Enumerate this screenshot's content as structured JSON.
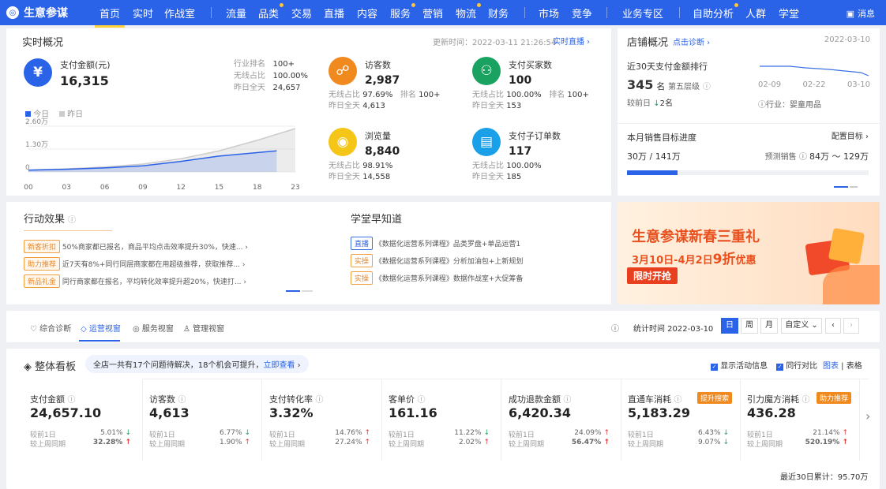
{
  "nav": {
    "brand": "生意参谋",
    "items": [
      "首页",
      "实时",
      "作战室",
      "流量",
      "品类",
      "交易",
      "直播",
      "内容",
      "服务",
      "营销",
      "物流",
      "财务",
      "市场",
      "竞争",
      "业务专区",
      "自助分析",
      "人群",
      "学堂"
    ],
    "message": "消息"
  },
  "realtime": {
    "title": "实时概况",
    "update_time": "更新时间：2022-03-11 21:26:54",
    "live_link": "实时直播",
    "pay_label": "支付金额(元)",
    "pay_value": "16,315",
    "rank_label": "行业排名",
    "rank_value": "100+",
    "wireless_label": "无线占比",
    "wireless_value": "100.00%",
    "yesterday_label": "昨日全天",
    "yesterday_value": "24,657",
    "metrics": [
      {
        "name": "访客数",
        "value": "2,987",
        "l1": "无线占比",
        "v1": "97.69%",
        "l1b": "排名",
        "v1b": "100+",
        "l2": "昨日全天",
        "v2": "4,613"
      },
      {
        "name": "支付买家数",
        "value": "100",
        "l1": "无线占比",
        "v1": "100.00%",
        "l1b": "排名",
        "v1b": "100+",
        "l2": "昨日全天",
        "v2": "153"
      },
      {
        "name": "浏览量",
        "value": "8,840",
        "l1": "无线占比",
        "v1": "98.91%",
        "l2": "昨日全天",
        "v2": "14,558"
      },
      {
        "name": "支付子订单数",
        "value": "117",
        "l1": "无线占比",
        "v1": "100.00%",
        "l2": "昨日全天",
        "v2": "185"
      }
    ],
    "legend_today": "今日",
    "legend_yesterday": "昨日"
  },
  "chart_data": {
    "type": "area",
    "x": [
      "00",
      "03",
      "06",
      "09",
      "12",
      "15",
      "18",
      "23"
    ],
    "ylabels": [
      "2.60万",
      "1.30万",
      "0"
    ],
    "series": [
      {
        "name": "今日",
        "values": [
          1000,
          1500,
          2300,
          3500,
          6000,
          9000,
          12000,
          16315
        ]
      },
      {
        "name": "昨日",
        "values": [
          1100,
          1800,
          2800,
          4500,
          7500,
          12000,
          18000,
          24657
        ]
      }
    ]
  },
  "shop": {
    "title": "店铺概况",
    "diag": "点击诊断",
    "date": "2022-03-10",
    "rank_title": "近30天支付金额排行",
    "rank_value": "345",
    "rank_unit": "名",
    "level": "第五层级",
    "compare": "较前日",
    "compare_val": "2名",
    "industry": "行业：",
    "industry_val": "婴童用品",
    "dates": [
      "02-09",
      "02-22",
      "03-10"
    ],
    "target_title": "本月销售目标进度",
    "target_link": "配置目标",
    "target_value": "30万 / 141万",
    "forecast_label": "预测销售",
    "forecast_value": "84万 ～ 129万",
    "progress": 0.21
  },
  "action": {
    "title": "行动效果",
    "items": [
      {
        "tag": "新客折扣",
        "text": "50%商家都已报名，商品平均点击效率提升30%，快速..."
      },
      {
        "tag": "助力推荐",
        "text": "近7天有8%+同行同层商家都在用超级推荐，获取推荐..."
      },
      {
        "tag": "新品礼金",
        "text": "同行商家都在报名，平均转化效率提升超20%，快速打..."
      }
    ]
  },
  "learn": {
    "title": "学堂早知道",
    "items": [
      {
        "tag": "直播",
        "text": "《数据化运营系列课程》品类罗盘+单品运营1"
      },
      {
        "tag": "实操",
        "text": "《数据化运营系列课程》分析加油包+上新规划"
      },
      {
        "tag": "实操",
        "text": "《数据化运营系列课程》数据作战室+大促筹备"
      }
    ]
  },
  "banner": {
    "title": "生意参谋新春三重礼",
    "sub1": "3月10日-4月2日",
    "sub2": "9折",
    "sub3": "优惠",
    "btn": "限时开抢"
  },
  "tabs": {
    "items": [
      "综合诊断",
      "运营视窗",
      "服务视窗",
      "管理视窗"
    ],
    "stat_time": "统计时间 2022-03-10",
    "periods": [
      "日",
      "周",
      "月",
      "自定义"
    ]
  },
  "board": {
    "title": "整体看板",
    "notice": "全店一共有17个问题待解决，18个机会可提升，",
    "notice_link": "立即查看",
    "opt1": "显示活动信息",
    "opt2": "同行对比",
    "view1": "图表",
    "view2": "表格",
    "total": "最近30日累计：95.70万",
    "kpis": [
      {
        "name": "支付金额",
        "value": "24,657.10",
        "d1": "5.01%",
        "a1": "dn",
        "d2": "32.28%",
        "a2": "up",
        "red2": true
      },
      {
        "name": "访客数",
        "value": "4,613",
        "d1": "6.77%",
        "a1": "dn",
        "d2": "1.90%",
        "a2": "up"
      },
      {
        "name": "支付转化率",
        "value": "3.32%",
        "d1": "14.76%",
        "a1": "up",
        "d2": "27.24%",
        "a2": "up"
      },
      {
        "name": "客单价",
        "value": "161.16",
        "d1": "11.22%",
        "a1": "dn",
        "d2": "2.02%",
        "a2": "up"
      },
      {
        "name": "成功退款金额",
        "value": "6,420.34",
        "d1": "24.09%",
        "a1": "up",
        "d2": "56.47%",
        "a2": "up",
        "red2": true
      },
      {
        "name": "直通车消耗",
        "value": "5,183.29",
        "d1": "6.43%",
        "a1": "dn",
        "d2": "9.07%",
        "a2": "dn",
        "badge": "提升搜索"
      },
      {
        "name": "引力魔方消耗",
        "value": "436.28",
        "d1": "21.14%",
        "a1": "up",
        "d2": "520.19%",
        "a2": "up",
        "red2": true,
        "badge": "助力推荐"
      }
    ],
    "lbl1": "较前1日",
    "lbl2": "较上周同期"
  },
  "colors": {
    "primary": "#2a62e8",
    "orange": "#f08a1f",
    "green": "#1aa260",
    "red": "#e03a3a"
  }
}
